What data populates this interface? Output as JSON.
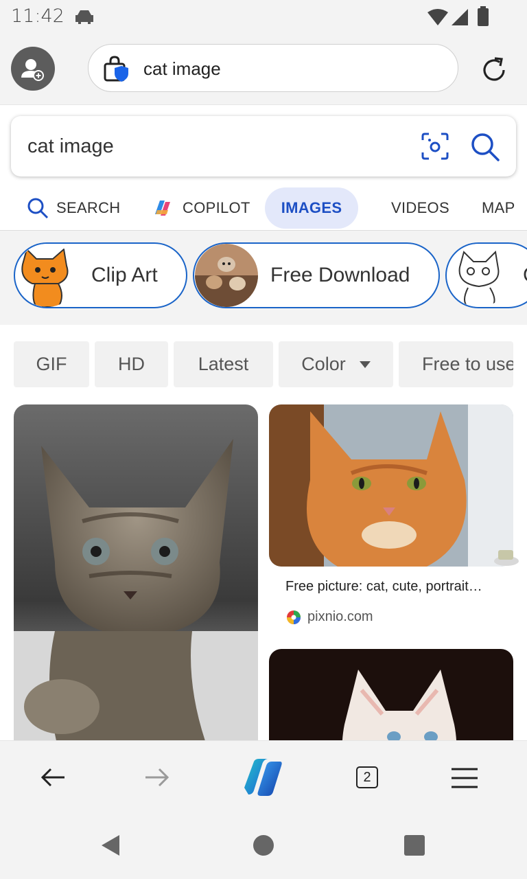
{
  "status": {
    "time": "11:42"
  },
  "toolbar": {
    "url": "cat image"
  },
  "search": {
    "query": "cat image"
  },
  "tabs": [
    {
      "label": "SEARCH"
    },
    {
      "label": "COPILOT"
    },
    {
      "label": "IMAGES"
    },
    {
      "label": "VIDEOS"
    },
    {
      "label": "MAP"
    }
  ],
  "suggestions": [
    {
      "label": "Clip Art"
    },
    {
      "label": "Free Download"
    },
    {
      "label": "C"
    }
  ],
  "filters": [
    {
      "label": "GIF"
    },
    {
      "label": "HD"
    },
    {
      "label": "Latest"
    },
    {
      "label": "Color"
    },
    {
      "label": "Free to use"
    }
  ],
  "results": [
    {
      "caption": "Free picture: cat, cute, portrait…",
      "source": "pixnio.com"
    }
  ],
  "bottombar": {
    "tab_count": "2"
  },
  "colors": {
    "accent": "#1d4fc4",
    "active_tab_bg": "#e3e8fa",
    "chip_border": "#1a64c8"
  }
}
